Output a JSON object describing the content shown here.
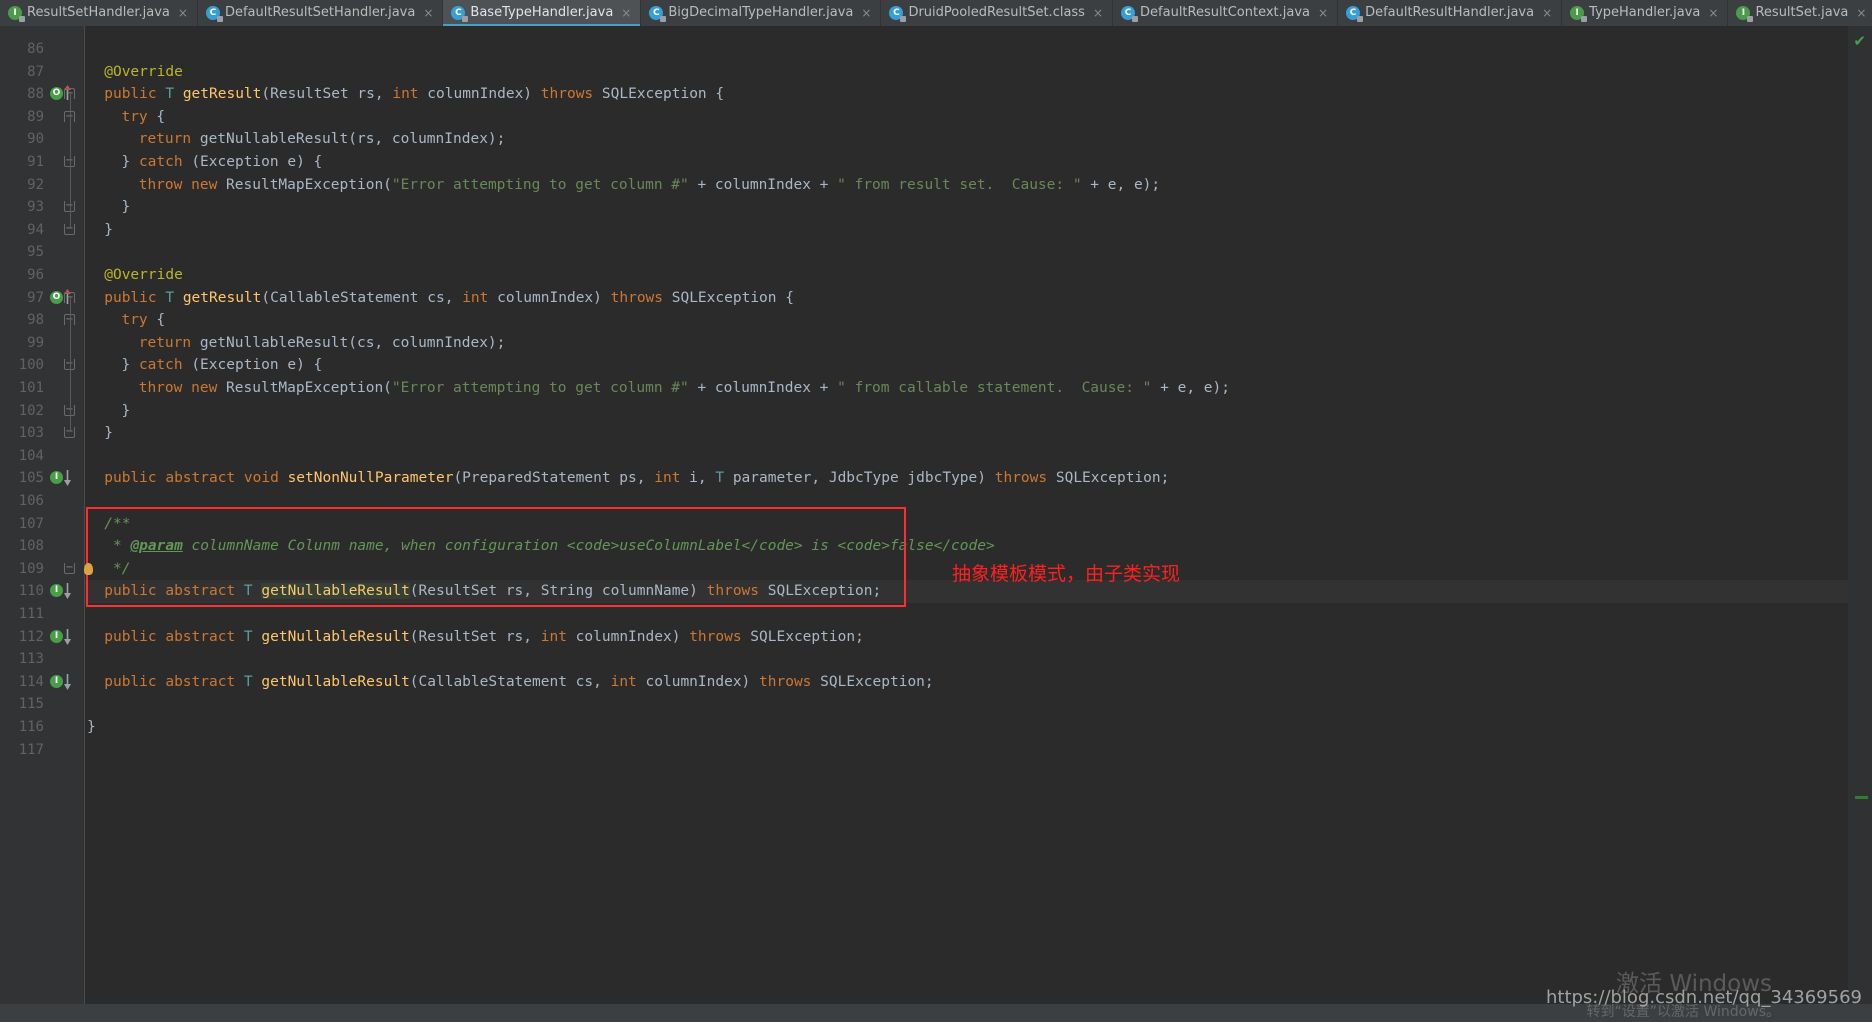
{
  "tabs": [
    {
      "label": "ResultSetHandler.java",
      "icon": "interface-icon",
      "kind": "iface",
      "active": false,
      "close": "×"
    },
    {
      "label": "DefaultResultSetHandler.java",
      "icon": "class-icon",
      "kind": "cls",
      "active": false,
      "close": "×"
    },
    {
      "label": "BaseTypeHandler.java",
      "icon": "class-icon",
      "kind": "cls",
      "active": true,
      "close": "×"
    },
    {
      "label": "BigDecimalTypeHandler.java",
      "icon": "class-icon",
      "kind": "cls",
      "active": false,
      "close": "×"
    },
    {
      "label": "DruidPooledResultSet.class",
      "icon": "class-icon",
      "kind": "cls",
      "active": false,
      "close": "×"
    },
    {
      "label": "DefaultResultContext.java",
      "icon": "class-icon",
      "kind": "cls",
      "active": false,
      "close": "×"
    },
    {
      "label": "DefaultResultHandler.java",
      "icon": "class-icon",
      "kind": "cls",
      "active": false,
      "close": "×"
    },
    {
      "label": "TypeHandler.java",
      "icon": "interface-icon",
      "kind": "iface",
      "active": false,
      "close": "×"
    },
    {
      "label": "ResultSet.java",
      "icon": "interface-icon",
      "kind": "iface",
      "active": false,
      "close": "×"
    }
  ],
  "tab_icon_glyphs": {
    "cls": "C",
    "iface": "I"
  },
  "editor": {
    "first_line": 86,
    "last_line": 117,
    "caret_line": 110,
    "highlighted_identifier": "getNullableResult",
    "lines": [
      {
        "n": 86,
        "indent": 0,
        "tokens": []
      },
      {
        "n": 87,
        "indent": 2,
        "tokens": [
          {
            "t": "@Override",
            "c": "anno"
          }
        ],
        "gutterFold": false
      },
      {
        "n": 88,
        "indent": 2,
        "tokens": [
          {
            "t": "public ",
            "c": "kw"
          },
          {
            "t": "T",
            "c": "gen"
          },
          {
            "t": " ",
            "c": "plain"
          },
          {
            "t": "getResult",
            "c": "fn"
          },
          {
            "t": "(",
            "c": "punc"
          },
          {
            "t": "ResultSet rs, ",
            "c": "plain"
          },
          {
            "t": "int",
            "c": "kw"
          },
          {
            "t": " columnIndex)",
            "c": "plain"
          },
          {
            "t": " ",
            "c": "plain"
          },
          {
            "t": "throws",
            "c": "kw"
          },
          {
            "t": " SQLException {",
            "c": "plain"
          }
        ],
        "marker": "override-up",
        "fold": "open"
      },
      {
        "n": 89,
        "indent": 4,
        "tokens": [
          {
            "t": "try",
            "c": "kw"
          },
          {
            "t": " {",
            "c": "plain"
          }
        ],
        "fold": "open"
      },
      {
        "n": 90,
        "indent": 6,
        "tokens": [
          {
            "t": "return",
            "c": "kw"
          },
          {
            "t": " getNullableResult(rs, columnIndex);",
            "c": "plain"
          }
        ]
      },
      {
        "n": 91,
        "indent": 4,
        "tokens": [
          {
            "t": "} ",
            "c": "plain"
          },
          {
            "t": "catch",
            "c": "kw"
          },
          {
            "t": " (Exception e) {",
            "c": "plain"
          }
        ],
        "fold": "close"
      },
      {
        "n": 92,
        "indent": 6,
        "tokens": [
          {
            "t": "throw",
            "c": "kw"
          },
          {
            "t": " ",
            "c": "plain"
          },
          {
            "t": "new",
            "c": "kw"
          },
          {
            "t": " ResultMapException(",
            "c": "plain"
          },
          {
            "t": "\"Error attempting to get column #\"",
            "c": "str"
          },
          {
            "t": " + columnIndex + ",
            "c": "plain"
          },
          {
            "t": "\" from result set.  Cause: \"",
            "c": "str"
          },
          {
            "t": " + e, e);",
            "c": "plain"
          }
        ]
      },
      {
        "n": 93,
        "indent": 4,
        "tokens": [
          {
            "t": "}",
            "c": "plain"
          }
        ],
        "fold": "close"
      },
      {
        "n": 94,
        "indent": 2,
        "tokens": [
          {
            "t": "}",
            "c": "plain"
          }
        ],
        "fold": "close"
      },
      {
        "n": 95,
        "indent": 0,
        "tokens": []
      },
      {
        "n": 96,
        "indent": 2,
        "tokens": [
          {
            "t": "@Override",
            "c": "anno"
          }
        ]
      },
      {
        "n": 97,
        "indent": 2,
        "tokens": [
          {
            "t": "public ",
            "c": "kw"
          },
          {
            "t": "T",
            "c": "gen"
          },
          {
            "t": " ",
            "c": "plain"
          },
          {
            "t": "getResult",
            "c": "fn"
          },
          {
            "t": "(",
            "c": "punc"
          },
          {
            "t": "CallableStatement cs, ",
            "c": "plain"
          },
          {
            "t": "int",
            "c": "kw"
          },
          {
            "t": " columnIndex)",
            "c": "plain"
          },
          {
            "t": " ",
            "c": "plain"
          },
          {
            "t": "throws",
            "c": "kw"
          },
          {
            "t": " SQLException {",
            "c": "plain"
          }
        ],
        "marker": "override-up",
        "fold": "open"
      },
      {
        "n": 98,
        "indent": 4,
        "tokens": [
          {
            "t": "try",
            "c": "kw"
          },
          {
            "t": " {",
            "c": "plain"
          }
        ],
        "fold": "open"
      },
      {
        "n": 99,
        "indent": 6,
        "tokens": [
          {
            "t": "return",
            "c": "kw"
          },
          {
            "t": " getNullableResult(cs, columnIndex);",
            "c": "plain"
          }
        ]
      },
      {
        "n": 100,
        "indent": 4,
        "tokens": [
          {
            "t": "} ",
            "c": "plain"
          },
          {
            "t": "catch",
            "c": "kw"
          },
          {
            "t": " (Exception e) {",
            "c": "plain"
          }
        ],
        "fold": "close"
      },
      {
        "n": 101,
        "indent": 6,
        "tokens": [
          {
            "t": "throw",
            "c": "kw"
          },
          {
            "t": " ",
            "c": "plain"
          },
          {
            "t": "new",
            "c": "kw"
          },
          {
            "t": " ResultMapException(",
            "c": "plain"
          },
          {
            "t": "\"Error attempting to get column #\"",
            "c": "str"
          },
          {
            "t": " + columnIndex + ",
            "c": "plain"
          },
          {
            "t": "\" from callable statement.  Cause: \"",
            "c": "str"
          },
          {
            "t": " + e, e);",
            "c": "plain"
          }
        ]
      },
      {
        "n": 102,
        "indent": 4,
        "tokens": [
          {
            "t": "}",
            "c": "plain"
          }
        ],
        "fold": "close"
      },
      {
        "n": 103,
        "indent": 2,
        "tokens": [
          {
            "t": "}",
            "c": "plain"
          }
        ],
        "fold": "close"
      },
      {
        "n": 104,
        "indent": 0,
        "tokens": []
      },
      {
        "n": 105,
        "indent": 2,
        "tokens": [
          {
            "t": "public abstract void ",
            "c": "kw"
          },
          {
            "t": "setNonNullParameter",
            "c": "fn"
          },
          {
            "t": "(PreparedStatement ps, ",
            "c": "plain"
          },
          {
            "t": "int",
            "c": "kw"
          },
          {
            "t": " i, ",
            "c": "plain"
          },
          {
            "t": "T",
            "c": "gen"
          },
          {
            "t": " parameter, JdbcType jdbcType)",
            "c": "plain"
          },
          {
            "t": " ",
            "c": "plain"
          },
          {
            "t": "throws",
            "c": "kw"
          },
          {
            "t": " SQLException;",
            "c": "plain"
          }
        ],
        "marker": "impl-down"
      },
      {
        "n": 106,
        "indent": 0,
        "tokens": []
      },
      {
        "n": 107,
        "indent": 2,
        "tokens": [
          {
            "t": "/**",
            "c": "cmt"
          }
        ]
      },
      {
        "n": 108,
        "indent": 2,
        "tokens": [
          {
            "t": " * ",
            "c": "cmt"
          },
          {
            "t": "@param",
            "c": "cmtp"
          },
          {
            "t": " columnName Colunm name, when configuration <code>useColumnLabel</code> is <code>false</code>",
            "c": "cmt"
          }
        ]
      },
      {
        "n": 109,
        "indent": 2,
        "tokens": [
          {
            "t": " */",
            "c": "cmt"
          }
        ],
        "bulb": true,
        "fold": "close"
      },
      {
        "n": 110,
        "indent": 2,
        "tokens": [
          {
            "t": "public abstract ",
            "c": "kw"
          },
          {
            "t": "T",
            "c": "gen"
          },
          {
            "t": " ",
            "c": "plain"
          },
          {
            "t": "getNullableResult",
            "c": "fn",
            "hl": true
          },
          {
            "t": "(ResultSet rs, String columnName)",
            "c": "plain"
          },
          {
            "t": " ",
            "c": "plain"
          },
          {
            "t": "throws",
            "c": "kw"
          },
          {
            "t": " SQLException;",
            "c": "plain"
          }
        ],
        "marker": "impl-down",
        "caret": true
      },
      {
        "n": 111,
        "indent": 0,
        "tokens": []
      },
      {
        "n": 112,
        "indent": 2,
        "tokens": [
          {
            "t": "public abstract ",
            "c": "kw"
          },
          {
            "t": "T",
            "c": "gen"
          },
          {
            "t": " ",
            "c": "plain"
          },
          {
            "t": "getNullableResult",
            "c": "fn"
          },
          {
            "t": "(ResultSet rs, ",
            "c": "plain"
          },
          {
            "t": "int",
            "c": "kw"
          },
          {
            "t": " columnIndex)",
            "c": "plain"
          },
          {
            "t": " ",
            "c": "plain"
          },
          {
            "t": "throws",
            "c": "kw"
          },
          {
            "t": " SQLException;",
            "c": "plain"
          }
        ],
        "marker": "impl-down"
      },
      {
        "n": 113,
        "indent": 0,
        "tokens": []
      },
      {
        "n": 114,
        "indent": 2,
        "tokens": [
          {
            "t": "public abstract ",
            "c": "kw"
          },
          {
            "t": "T",
            "c": "gen"
          },
          {
            "t": " ",
            "c": "plain"
          },
          {
            "t": "getNullableResult",
            "c": "fn"
          },
          {
            "t": "(CallableStatement cs, ",
            "c": "plain"
          },
          {
            "t": "int",
            "c": "kw"
          },
          {
            "t": " columnIndex)",
            "c": "plain"
          },
          {
            "t": " ",
            "c": "plain"
          },
          {
            "t": "throws",
            "c": "kw"
          },
          {
            "t": " SQLException;",
            "c": "plain"
          }
        ],
        "marker": "impl-down"
      },
      {
        "n": 115,
        "indent": 0,
        "tokens": []
      },
      {
        "n": 116,
        "indent": 0,
        "tokens": [
          {
            "t": "}",
            "c": "plain"
          }
        ]
      },
      {
        "n": 117,
        "indent": 0,
        "tokens": []
      }
    ]
  },
  "annotation": {
    "text": "抽象模板模式，由子类实现",
    "color": "#ff2020",
    "box_color": "#ff2d2d"
  },
  "watermark": {
    "csdn": "https://blog.csdn.net/qq_34369569",
    "windows_line1": "激活 Windows",
    "windows_line2": "转到“设置”以激活 Windows。"
  },
  "right_gutter": {
    "status_icon": "✔",
    "status_color": "#4a9b4a"
  },
  "colors": {
    "background": "#2b2b2b",
    "gutter": "#313335",
    "tabbar": "#3c3f41",
    "active_tab": "#4e5254",
    "accent": "#4a9ec4",
    "keyword": "#cc7832",
    "string": "#6a8759",
    "comment": "#629755",
    "annotation": "#bbb529",
    "function": "#ffc66d",
    "text": "#a9b7c6"
  }
}
